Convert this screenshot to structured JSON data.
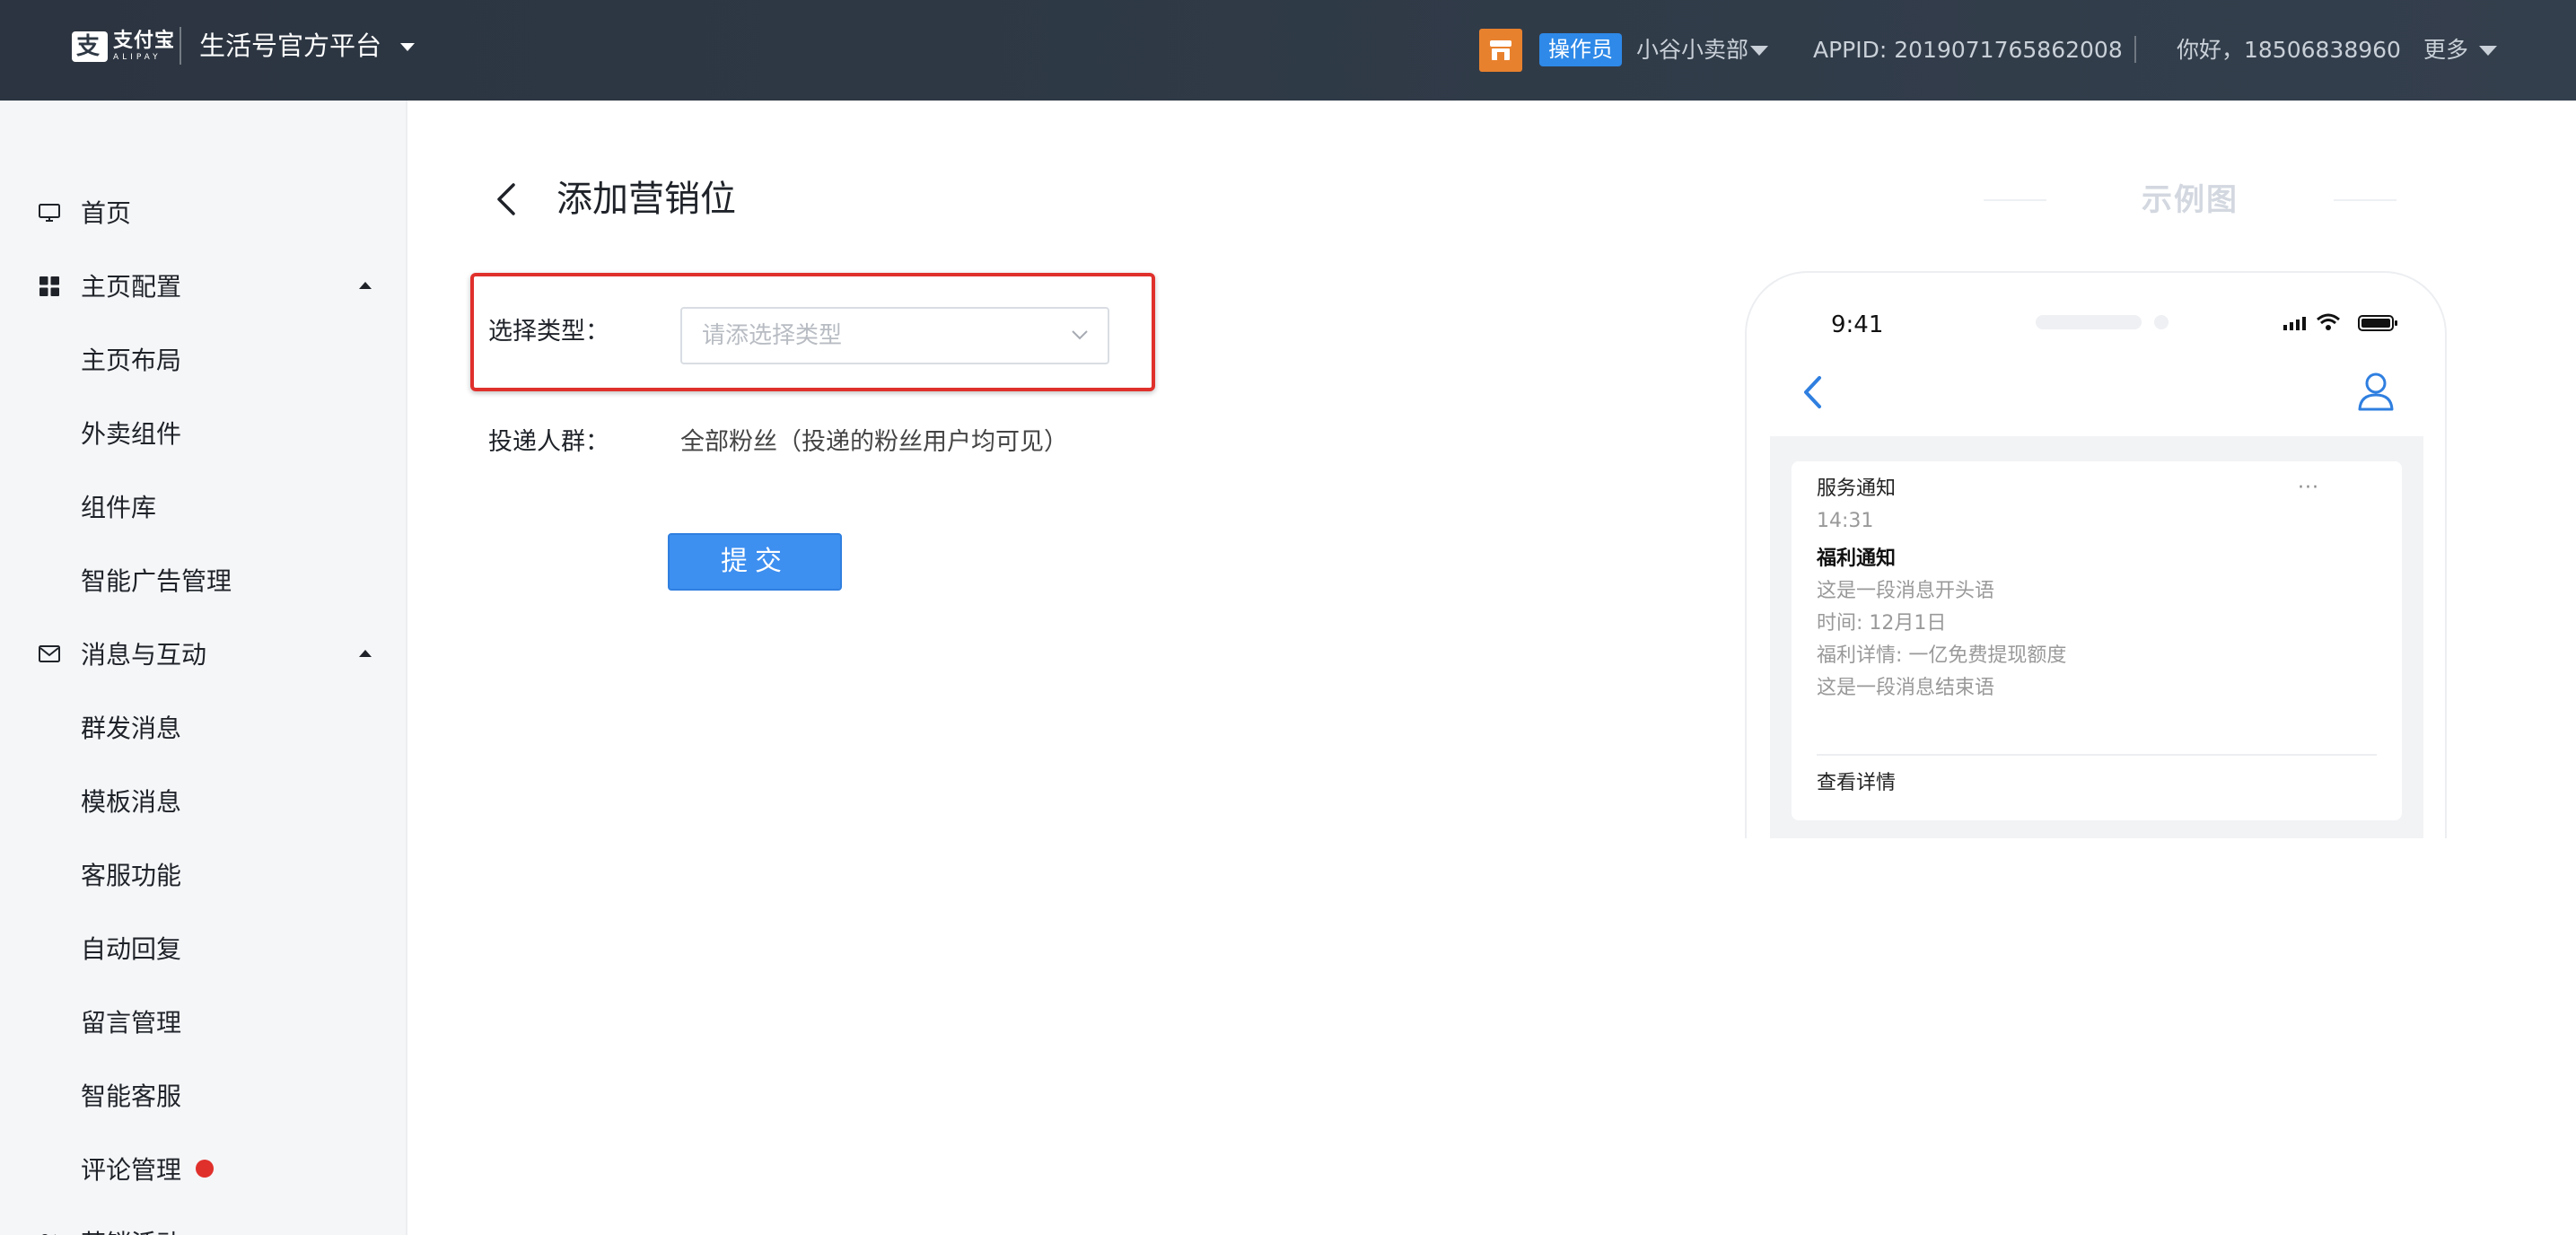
{
  "header": {
    "logo_cn": "支付宝",
    "logo_en": "ALIPAY",
    "platform": "生活号官方平台",
    "role": "操作员",
    "shop": "小谷小卖部",
    "appid": "APPID: 2019071765862008",
    "greeting": "你好，18506838960",
    "more": "更多"
  },
  "sidebar": {
    "items": [
      {
        "label": "首页",
        "icon": "monitor-icon"
      },
      {
        "label": "主页配置",
        "icon": "grid-icon",
        "expanded": true
      },
      {
        "label": "主页布局"
      },
      {
        "label": "外卖组件"
      },
      {
        "label": "组件库"
      },
      {
        "label": "智能广告管理"
      },
      {
        "label": "消息与互动",
        "icon": "mail-icon",
        "expanded": true
      },
      {
        "label": "群发消息"
      },
      {
        "label": "模板消息"
      },
      {
        "label": "客服功能"
      },
      {
        "label": "自动回复"
      },
      {
        "label": "留言管理"
      },
      {
        "label": "智能客服"
      },
      {
        "label": "评论管理",
        "badge": "red-dot"
      },
      {
        "label": "营销活动",
        "icon": "marketing-icon"
      }
    ]
  },
  "main": {
    "title": "添加营销位",
    "form": {
      "type_label": "选择类型：",
      "type_placeholder": "请添选择类型",
      "audience_label": "投递人群：",
      "audience_value": "全部粉丝（投递的粉丝用户均可见）",
      "submit_label": "提交"
    }
  },
  "preview": {
    "title": "示例图",
    "phone_time": "9:41",
    "message": {
      "sender": "服务通知",
      "time": "14:31",
      "more": "···",
      "heading": "福利通知",
      "lines": [
        "这是一段消息开头语",
        "时间: 12月1日",
        "福利详情: 一亿免费提现额度",
        "这是一段消息结束语"
      ],
      "link": "查看详情"
    }
  },
  "colors": {
    "topbar": "#2e3844",
    "accent": "#3d8ff0",
    "highlight": "#e0302c",
    "shop_icon": "#e8812e"
  }
}
